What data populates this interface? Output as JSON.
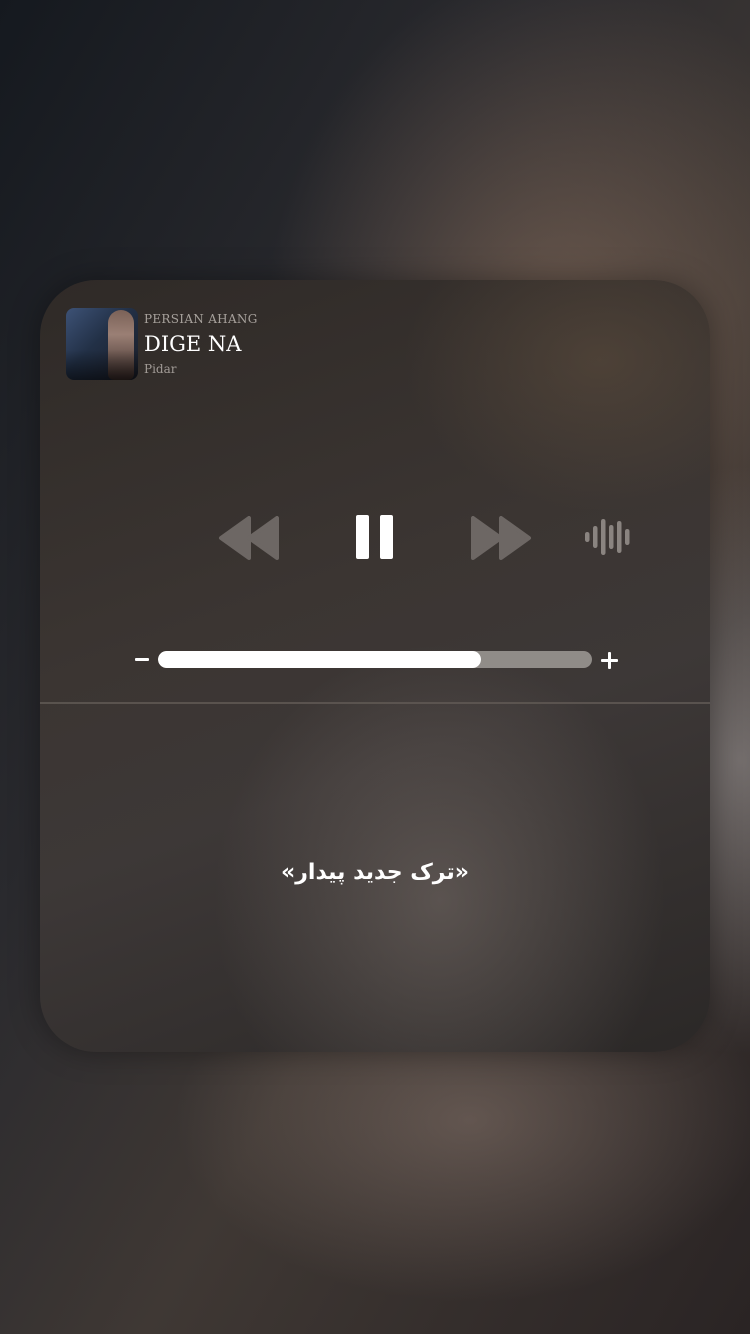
{
  "now_playing": {
    "source": "PERSIAN AHANG",
    "title": "DIGE NA",
    "artist": "Pidar",
    "artwork_icon": "album-artwork"
  },
  "controls": {
    "rewind_icon": "rewind-icon",
    "pause_icon": "pause-icon",
    "fast_forward_icon": "fast-forward-icon",
    "audio_output_icon": "waveform-icon"
  },
  "volume": {
    "level": 0.745,
    "minus_icon": "minus-icon",
    "plus_icon": "plus-icon"
  },
  "caption": "«ترک جدید پیدار»",
  "colors": {
    "primary_text": "#ffffff",
    "secondary_text": "#a7a19c",
    "inactive_icon": "#7c7672"
  }
}
